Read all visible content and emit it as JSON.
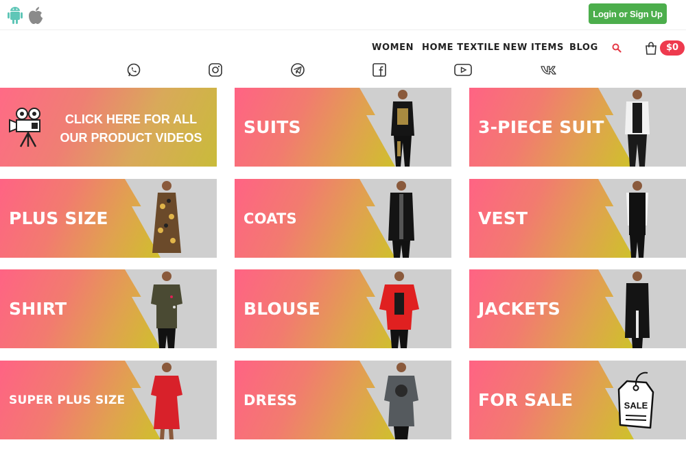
{
  "header": {
    "login_label": "Login or Sign Up",
    "app_icons": [
      "android-icon",
      "apple-icon"
    ]
  },
  "nav": {
    "items": [
      {
        "label": "WOMEN"
      },
      {
        "label": "HOME TEXTILE"
      },
      {
        "label": "NEW ITEMS"
      },
      {
        "label": "BLOG"
      }
    ],
    "cart_total": "$0"
  },
  "social": [
    "whatsapp-icon",
    "instagram-icon",
    "telegram-icon",
    "facebook-icon",
    "youtube-icon",
    "vk-icon"
  ],
  "colors": {
    "login_green": "#4cae4c",
    "badge_red": "#ee3a4e",
    "tile_pink": "#ff6384",
    "tile_yellow": "#c9c425",
    "stripe_gray": "#d0d0d0"
  },
  "categories": {
    "videos": {
      "line1": "CLICK HERE FOR ALL",
      "line2": "OUR PRODUCT VIDEOS"
    },
    "suits": "SUITS",
    "three_piece": "3-PIECE SUIT",
    "plus_size": "PLUS SIZE",
    "coats": "COATS",
    "vest": "VEST",
    "shirt": "SHIRT",
    "blouse": "BLOUSE",
    "jackets": "JACKETS",
    "super_plus": "SUPER PLUS SIZE",
    "dress": "DRESS",
    "for_sale": "FOR SALE",
    "sale_tag": "SALE"
  }
}
